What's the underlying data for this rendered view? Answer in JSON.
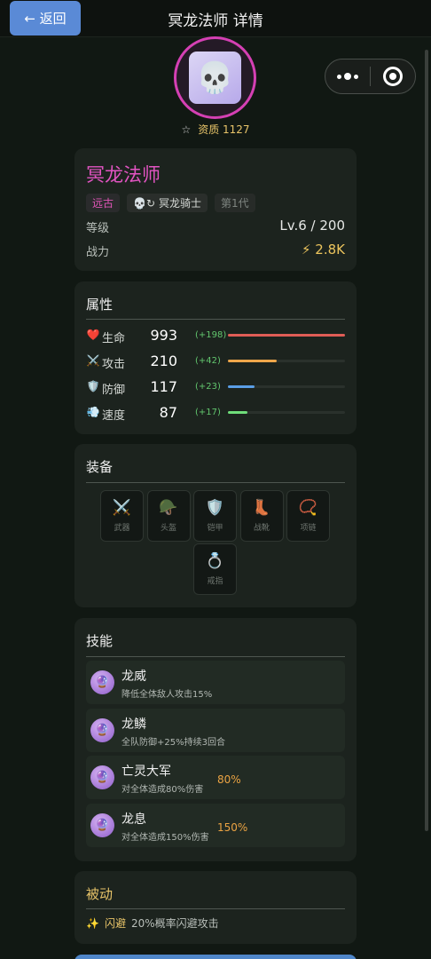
{
  "nav": {
    "back_label": "← 返回",
    "title": "冥龙法师 详情"
  },
  "avatar": {
    "icon": "skull-ghost",
    "glyph": "💀"
  },
  "aptitude": {
    "star_glyph": "☆",
    "label": "资质 1127"
  },
  "info": {
    "name": "冥龙法师",
    "tags": {
      "era": "远古",
      "faction_icons": "💀↻",
      "faction": "冥龙骑士",
      "generation": "第1代"
    },
    "level_label": "等级",
    "level_value": "Lv.6 / 200",
    "power_label": "战力",
    "power_icon": "⚡",
    "power_value": "2.8K"
  },
  "attributes": {
    "title": "属性",
    "rows": [
      {
        "icon": "heart-icon",
        "glyph": "❤️",
        "name": "生命",
        "value": "993",
        "bonus": "(+198)",
        "fill": 1.0,
        "color": "#e05d56"
      },
      {
        "icon": "swords-icon",
        "glyph": "⚔️",
        "name": "攻击",
        "value": "210",
        "bonus": "(+42)",
        "fill": 0.42,
        "color": "#eea64a"
      },
      {
        "icon": "shield-icon",
        "glyph": "🛡️",
        "name": "防御",
        "value": "117",
        "bonus": "(+23)",
        "fill": 0.23,
        "color": "#5a9ee6"
      },
      {
        "icon": "wind-icon",
        "glyph": "💨",
        "name": "速度",
        "value": "87",
        "bonus": "(+17)",
        "fill": 0.17,
        "color": "#6fdd7a"
      }
    ]
  },
  "equipment": {
    "title": "装备",
    "slots": [
      {
        "icon": "swords-icon",
        "glyph": "⚔️",
        "label": "武器"
      },
      {
        "icon": "helmet-icon",
        "glyph": "🪖",
        "label": "头盔"
      },
      {
        "icon": "shield-icon",
        "glyph": "🛡️",
        "label": "铠甲"
      },
      {
        "icon": "boot-icon",
        "glyph": "👢",
        "label": "战靴"
      },
      {
        "icon": "necklace-icon",
        "glyph": "📿",
        "label": "项链"
      },
      {
        "icon": "ring-icon",
        "glyph": "💍",
        "label": "戒指"
      }
    ]
  },
  "skills": {
    "title": "技能",
    "items": [
      {
        "name": "龙威",
        "desc": "降低全体敌人攻击15%",
        "pct": ""
      },
      {
        "name": "龙鳞",
        "desc": "全队防御+25%持续3回合",
        "pct": ""
      },
      {
        "name": "亡灵大军",
        "desc": "对全体造成80%伤害",
        "pct": "80%"
      },
      {
        "name": "龙息",
        "desc": "对全体造成150%伤害",
        "pct": "150%"
      }
    ],
    "icon_glyph": "🔮"
  },
  "passive": {
    "title": "被动",
    "icon_glyph": "✨",
    "name": "闪避",
    "desc": "20%概率闪避攻击"
  },
  "colors": {
    "accent": "#d540b4",
    "gold": "#e8c469",
    "button": "#5a8ad6"
  }
}
